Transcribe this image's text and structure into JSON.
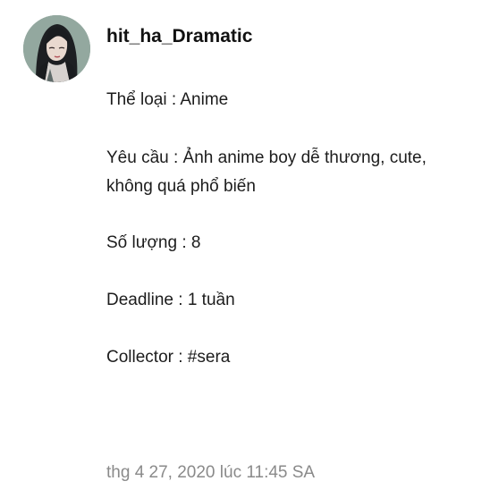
{
  "post": {
    "author": {
      "username": "hit_ha_Dramatic",
      "avatar_icon": "user-avatar-anime-girl"
    },
    "lines": {
      "genre": "Thể loại : Anime",
      "request": "Yêu cầu : Ảnh anime boy dễ thương, cute, không quá phổ biến",
      "quantity": "Số lượng : 8",
      "deadline": "Deadline : 1 tuần",
      "collector": "Collector : #sera"
    },
    "timestamp": "thg 4 27, 2020 lúc 11:45 SA"
  },
  "colors": {
    "text": "#1c1c1c",
    "username": "#111111",
    "timestamp": "#8a8a8a",
    "background": "#ffffff"
  }
}
